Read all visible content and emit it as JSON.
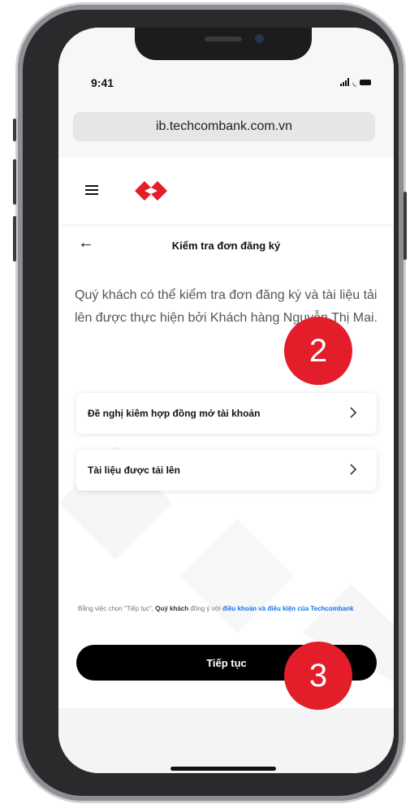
{
  "status_bar": {
    "time": "9:41"
  },
  "browser": {
    "url": "ib.techcombank.com.vn"
  },
  "header": {
    "logo": "Techcombank"
  },
  "page": {
    "title": "Kiểm tra đơn đăng ký",
    "description": "Quý khách có thể kiểm tra đơn đăng ký và tài liệu tải lên được thực hiện bởi Khách hàng Nguyễn Thị Mai."
  },
  "items": [
    {
      "label": "Đề nghị kiêm hợp đồng mở tài khoản"
    },
    {
      "label": "Tài liệu được tải lên"
    }
  ],
  "terms": {
    "prefix": "Bằng việc chọn \"Tiếp tục\", ",
    "bold": "Quý khách",
    "middle": " đồng ý với ",
    "link": "điều khoản và điều kiện của Techcombank"
  },
  "cta": {
    "label": "Tiếp tục"
  },
  "callouts": {
    "step2": "2",
    "step3": "3"
  },
  "colors": {
    "callout": "#e31e2a",
    "brand": "#e31e2a",
    "link": "#1a73e8"
  }
}
